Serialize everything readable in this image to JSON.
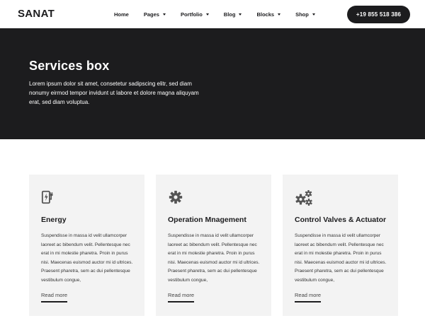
{
  "header": {
    "logo": "SANAT",
    "nav": [
      {
        "label": "Home",
        "dropdown": false
      },
      {
        "label": "Pages",
        "dropdown": true
      },
      {
        "label": "Portfolio",
        "dropdown": true
      },
      {
        "label": "Blog",
        "dropdown": true
      },
      {
        "label": "Blocks",
        "dropdown": true
      },
      {
        "label": "Shop",
        "dropdown": true
      }
    ],
    "phone": "+19 855 518 386"
  },
  "hero": {
    "title": "Services box",
    "text": "Lorem ipsum dolor sit amet, consetetur sadipscing elitr, sed diam nonumy eirmod tempor invidunt ut labore et dolore magna aliquyam erat, sed diam voluptua."
  },
  "cards": [
    {
      "icon": "ev-charger-icon",
      "title": "Energy",
      "text": "Suspendisse in massa id velit ullamcorper laoreet ac bibendum velit. Pellentesque nec erat in mi molestie pharetra. Proin in purus nisi. Maecenas euismod auctor mi id ultrices. Praesent pharetra, sem ac dui pellentesque vestibulum congue,",
      "link": "Read more"
    },
    {
      "icon": "gear-icon",
      "title": "Operation Mnagement",
      "text": "Suspendisse in massa id velit ullamcorper laoreet ac bibendum velit. Pellentesque nec erat in mi molestie pharetra. Proin in purus nisi. Maecenas euismod auctor mi id ultrices. Praesent pharetra, sem ac dui pellentesque vestibulum congue,",
      "link": "Read more"
    },
    {
      "icon": "gears-icon",
      "title": "Control Valves & Actuator",
      "text": "Suspendisse in massa id velit ullamcorper laoreet ac bibendum velit. Pellentesque nec erat in mi molestie pharetra. Proin in purus nisi. Maecenas euismod auctor mi id ultrices. Praesent pharetra, sem ac dui pellentesque vestibulum congue,",
      "link": "Read more"
    }
  ],
  "colors": {
    "dark": "#1c1c1e",
    "card_bg": "#f3f3f3",
    "icon": "#555555"
  }
}
